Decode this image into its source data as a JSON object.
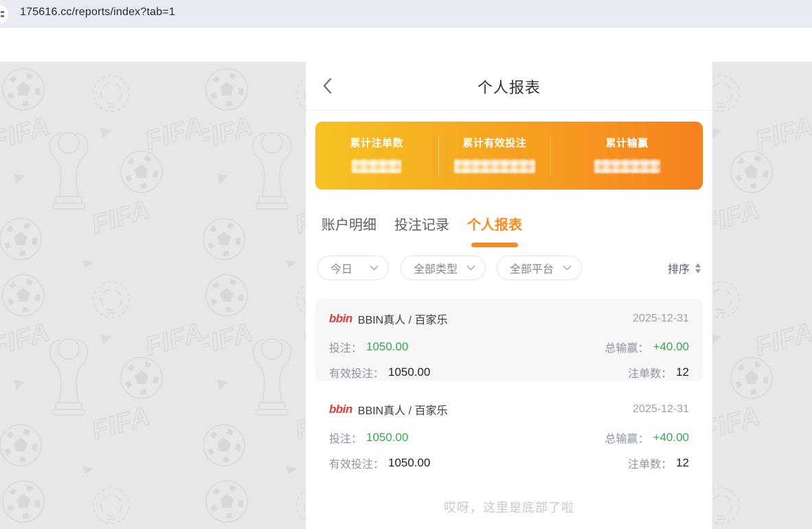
{
  "browser": {
    "url": "175616.cc/reports/index?tab=1"
  },
  "header": {
    "title": "个人报表"
  },
  "summary": {
    "items": [
      {
        "label": "累计注单数",
        "value_redacted": true
      },
      {
        "label": "累计有效投注",
        "value_redacted": true
      },
      {
        "label": "累计输赢",
        "value_redacted": true
      }
    ]
  },
  "tabs": [
    {
      "label": "账户明细",
      "active": false
    },
    {
      "label": "投注记录",
      "active": false
    },
    {
      "label": "个人报表",
      "active": true
    }
  ],
  "filters": {
    "date": "今日",
    "type": "全部类型",
    "platform": "全部平台",
    "sort_label": "排序"
  },
  "records": [
    {
      "provider_logo": "bbin",
      "game": "BBIN真人 / 百家乐",
      "date": "2025-12-31",
      "bet_label": "投注：",
      "bet_value": "1050.00",
      "winloss_label": "总输赢：",
      "winloss_value": "+40.00",
      "valid_label": "有效投注：",
      "valid_value": "1050.00",
      "count_label": "注单数：",
      "count_value": "12"
    },
    {
      "provider_logo": "bbin",
      "game": "BBIN真人 / 百家乐",
      "date": "2025-12-31",
      "bet_label": "投注：",
      "bet_value": "1050.00",
      "winloss_label": "总输赢：",
      "winloss_value": "+40.00",
      "valid_label": "有效投注：",
      "valid_value": "1050.00",
      "count_label": "注单数：",
      "count_value": "12"
    }
  ],
  "footer": {
    "end_text": "哎呀，这里是底部了啦"
  },
  "colors": {
    "accent_orange": "#ff8a1e",
    "gradient_from": "#f6c322",
    "gradient_to": "#f6811e",
    "positive_green": "#2fae49",
    "brand_red": "#e03a3a",
    "browser_bar": "#e9ecf5"
  }
}
